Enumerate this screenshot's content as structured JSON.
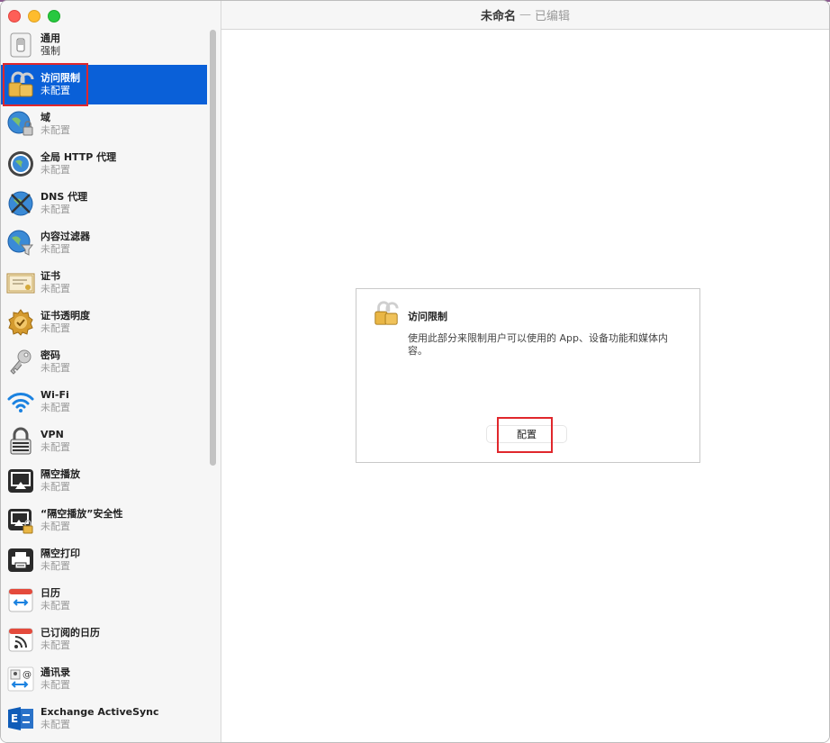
{
  "window": {
    "title": "未命名",
    "title_separator": "—",
    "title_status": "已编辑"
  },
  "sidebar": {
    "items": [
      {
        "label": "通用",
        "status": "强制",
        "icon": "switch-icon"
      },
      {
        "label": "访问限制",
        "status": "未配置",
        "icon": "padlock-icon"
      },
      {
        "label": "域",
        "status": "未配置",
        "icon": "globe-lock-icon"
      },
      {
        "label": "全局 HTTP 代理",
        "status": "未配置",
        "icon": "globe-proxy-icon"
      },
      {
        "label": "DNS 代理",
        "status": "未配置",
        "icon": "globe-dns-icon"
      },
      {
        "label": "内容过滤器",
        "status": "未配置",
        "icon": "globe-filter-icon"
      },
      {
        "label": "证书",
        "status": "未配置",
        "icon": "certificate-icon"
      },
      {
        "label": "证书透明度",
        "status": "未配置",
        "icon": "seal-icon"
      },
      {
        "label": "密码",
        "status": "未配置",
        "icon": "key-icon"
      },
      {
        "label": "Wi-Fi",
        "status": "未配置",
        "icon": "wifi-icon"
      },
      {
        "label": "VPN",
        "status": "未配置",
        "icon": "vpn-icon"
      },
      {
        "label": "隔空播放",
        "status": "未配置",
        "icon": "airplay-icon"
      },
      {
        "label": "“隔空播放”安全性",
        "status": "未配置",
        "icon": "airplay-lock-icon"
      },
      {
        "label": "隔空打印",
        "status": "未配置",
        "icon": "printer-icon"
      },
      {
        "label": "日历",
        "status": "未配置",
        "icon": "calendar-icon"
      },
      {
        "label": "已订阅的日历",
        "status": "未配置",
        "icon": "subscribed-calendar-icon"
      },
      {
        "label": "通讯录",
        "status": "未配置",
        "icon": "contacts-icon"
      },
      {
        "label": "Exchange ActiveSync",
        "status": "未配置",
        "icon": "exchange-icon"
      }
    ],
    "selected_index": 1
  },
  "card": {
    "title": "访问限制",
    "description": "使用此部分来限制用户可以使用的 App、设备功能和媒体内容。",
    "button_label": "配置"
  },
  "colors": {
    "selection": "#0a60d8",
    "highlight_outline": "#e0272c"
  }
}
